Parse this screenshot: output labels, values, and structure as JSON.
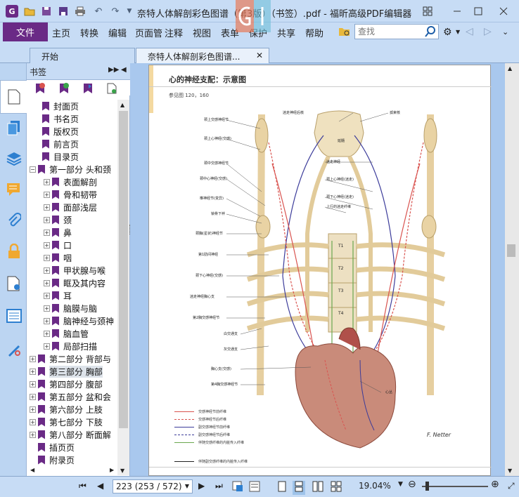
{
  "window": {
    "title": "奈特人体解剖彩色图谱（第3版）（书签）.pdf - 福昕高级PDF编辑器"
  },
  "ribbon": {
    "file": "文件",
    "tabs": [
      "主页",
      "转换",
      "编辑",
      "页面管",
      "注释",
      "视图",
      "表单",
      "保护",
      "共享",
      "帮助"
    ],
    "search_placeholder": "查找"
  },
  "tabs": [
    {
      "label": "开始",
      "active": false
    },
    {
      "label": "奈特人体解剖彩色图谱...",
      "active": true
    }
  ],
  "bookmarks": {
    "header": "书签",
    "items": [
      {
        "label": "封面页",
        "level": 1,
        "expander": "",
        "selected": false
      },
      {
        "label": "书名页",
        "level": 1,
        "expander": "",
        "selected": false
      },
      {
        "label": "版权页",
        "level": 1,
        "expander": "",
        "selected": false
      },
      {
        "label": "前言页",
        "level": 1,
        "expander": "",
        "selected": false
      },
      {
        "label": "目录页",
        "level": 1,
        "expander": "",
        "selected": false
      },
      {
        "label": "第一部分 头和颈",
        "level": 0,
        "expander": "−",
        "selected": false
      },
      {
        "label": "表面解剖",
        "level": 2,
        "expander": "+",
        "selected": false
      },
      {
        "label": "骨和韧带",
        "level": 2,
        "expander": "+",
        "selected": false
      },
      {
        "label": "面部浅层",
        "level": 2,
        "expander": "+",
        "selected": false
      },
      {
        "label": "颈",
        "level": 2,
        "expander": "+",
        "selected": false
      },
      {
        "label": "鼻",
        "level": 2,
        "expander": "+",
        "selected": false
      },
      {
        "label": "口",
        "level": 2,
        "expander": "+",
        "selected": false
      },
      {
        "label": "咽",
        "level": 2,
        "expander": "+",
        "selected": false
      },
      {
        "label": "甲状腺与喉",
        "level": 2,
        "expander": "+",
        "selected": false
      },
      {
        "label": "眶及其内容",
        "level": 2,
        "expander": "+",
        "selected": false
      },
      {
        "label": "耳",
        "level": 2,
        "expander": "+",
        "selected": false
      },
      {
        "label": "脑膜与脑",
        "level": 2,
        "expander": "+",
        "selected": false
      },
      {
        "label": "脑神经与颈神",
        "level": 2,
        "expander": "+",
        "selected": false
      },
      {
        "label": "脑血管",
        "level": 2,
        "expander": "+",
        "selected": false
      },
      {
        "label": "局部扫描",
        "level": 2,
        "expander": "+",
        "selected": false
      },
      {
        "label": "第二部分 背部与",
        "level": 0,
        "expander": "+",
        "selected": false
      },
      {
        "label": "第三部分 胸部",
        "level": 0,
        "expander": "+",
        "selected": true
      },
      {
        "label": "第四部分 腹部",
        "level": 0,
        "expander": "+",
        "selected": false
      },
      {
        "label": "第五部分 盆和会",
        "level": 0,
        "expander": "+",
        "selected": false
      },
      {
        "label": "第六部分 上肢",
        "level": 0,
        "expander": "+",
        "selected": false
      },
      {
        "label": "第七部分 下肢",
        "level": 0,
        "expander": "+",
        "selected": false
      },
      {
        "label": "第八部分 断面解",
        "level": 0,
        "expander": "+",
        "selected": false
      },
      {
        "label": "插页页",
        "level": 0,
        "expander": "",
        "selected": false
      },
      {
        "label": "附录页",
        "level": 0,
        "expander": "",
        "selected": false
      }
    ]
  },
  "page": {
    "heading": "心的神经支配：示意图",
    "ref": "参见图 120，160",
    "labels": {
      "top_center": "迷走神经后核",
      "top_right": "孤束核",
      "l1": "颈上交感神经节",
      "l2": "颈上心神经(交感)",
      "l3": "颈中交感神经节",
      "l4": "颈中心神经(交感)",
      "l5": "椎神经节(变异)",
      "l6": "锁骨下袢",
      "l7": "颈胸(星状)神经节",
      "l8": "第1肋间神经",
      "l9": "颈下心神经(交感)",
      "l10": "迷走神经胸心支",
      "l11": "第2胸交感神经节",
      "l12": "白交通支",
      "l13": "灰交通支",
      "l14": "胸心支(交感)",
      "l15": "第4胸交感神经节",
      "r1": "迷走神经",
      "r2": "颈上心神经(迷走)",
      "r3": "颈下心神经(迷走)",
      "r4": "上行的迷走纤维",
      "r5": "心丛",
      "t1": "T1",
      "t2": "T2",
      "t3": "T3",
      "t4": "T4",
      "brain": "延髓"
    },
    "legend": [
      {
        "label": "交感神经节前纤维",
        "color": "#d9534f",
        "dashed": false
      },
      {
        "label": "交感神经节后纤维",
        "color": "#d9534f",
        "dashed": true
      },
      {
        "label": "副交感神经节前纤维",
        "color": "#3b3b9a",
        "dashed": false
      },
      {
        "label": "副交感神经节后纤维",
        "color": "#3b3b9a",
        "dashed": true
      },
      {
        "label": "伴随交感纤维的内脏传入纤维",
        "color": "#6aa84f",
        "dashed": false
      },
      {
        "label": "伴随副交感纤维的内脏传入纤维",
        "color": "#222222",
        "dashed": false
      }
    ],
    "signature": "F. Netter"
  },
  "status": {
    "page_display": "223 (253 / 572)",
    "zoom": "19.04%"
  },
  "colors": {
    "accent": "#6a2a86",
    "chrome": "#c7dcf5",
    "doc_bg": "#a9c8ee"
  }
}
